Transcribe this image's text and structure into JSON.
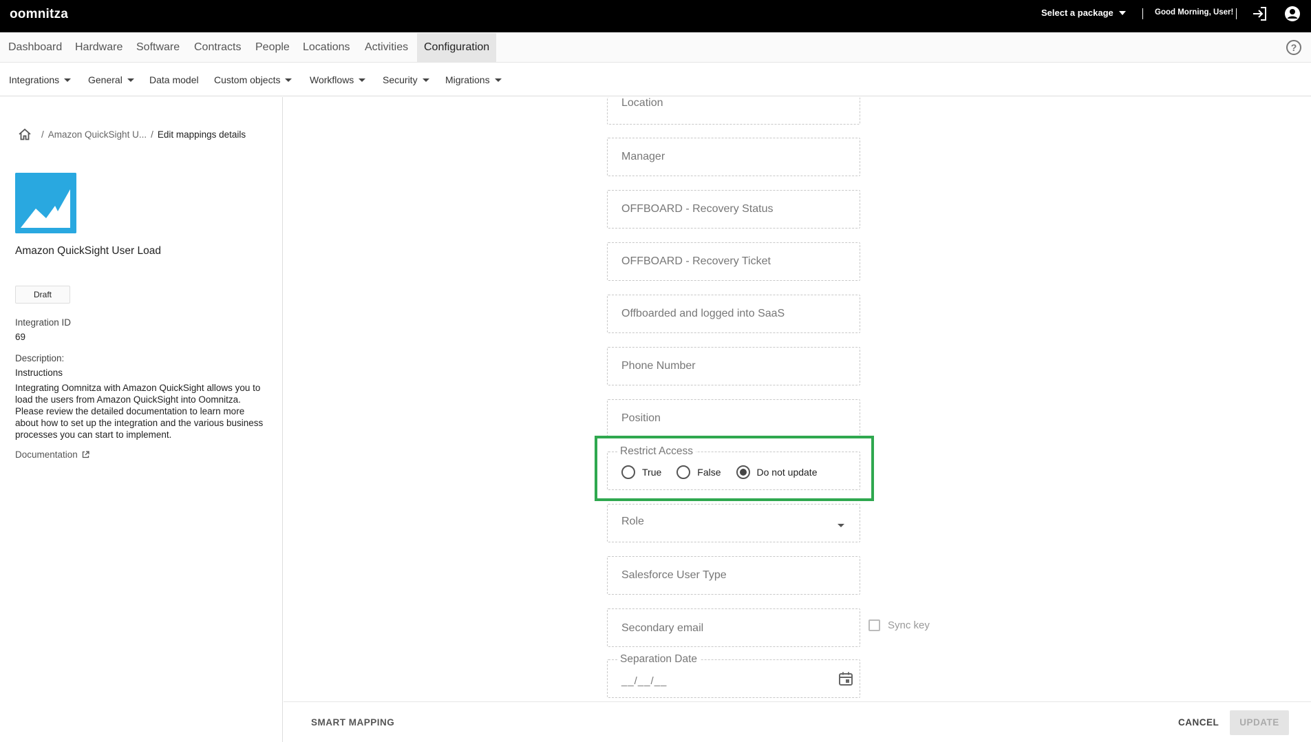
{
  "header": {
    "logo": "oomnitza",
    "package_label": "Select a package",
    "greeting": "Good Morning, User!"
  },
  "main_nav": [
    "Dashboard",
    "Hardware",
    "Software",
    "Contracts",
    "People",
    "Locations",
    "Activities",
    "Configuration"
  ],
  "active_main_nav": "Configuration",
  "sub_nav": [
    {
      "label": "Integrations",
      "dropdown": true
    },
    {
      "label": "General",
      "dropdown": true
    },
    {
      "label": "Data model",
      "dropdown": false
    },
    {
      "label": "Custom objects",
      "dropdown": true
    },
    {
      "label": "Workflows",
      "dropdown": true
    },
    {
      "label": "Security",
      "dropdown": true
    },
    {
      "label": "Migrations",
      "dropdown": true
    }
  ],
  "breadcrumb": {
    "parent": "Amazon QuickSight U...",
    "current": "Edit mappings details"
  },
  "integration": {
    "name": "Amazon QuickSight User Load",
    "status": "Draft",
    "id_label": "Integration ID",
    "id_value": "69",
    "description_label": "Description:",
    "instructions_title": "Instructions",
    "description": "Integrating Oomnitza with Amazon QuickSight allows you to load the users from Amazon QuickSight into Oomnitza. Please review the detailed documentation to learn more about how to set up the integration and the various business processes you can start to implement.",
    "documentation_link": "Documentation"
  },
  "fields": {
    "location": "Location",
    "manager": "Manager",
    "offboard_status": "OFFBOARD - Recovery Status",
    "offboard_ticket": "OFFBOARD - Recovery Ticket",
    "offboarded_saas": "Offboarded and logged into SaaS",
    "phone": "Phone Number",
    "position": "Position",
    "restrict_access": {
      "label": "Restrict Access",
      "options": [
        "True",
        "False",
        "Do not update"
      ],
      "selected": "Do not update"
    },
    "role": "Role",
    "salesforce_user_type": "Salesforce User Type",
    "secondary_email": "Secondary email",
    "sync_key_label": "Sync key",
    "separation_date": {
      "label": "Separation Date",
      "placeholder": "__/__/__"
    }
  },
  "highlight_color": "#2fa84f",
  "footer": {
    "smart_mapping": "SMART MAPPING",
    "cancel": "CANCEL",
    "update": "UPDATE"
  }
}
